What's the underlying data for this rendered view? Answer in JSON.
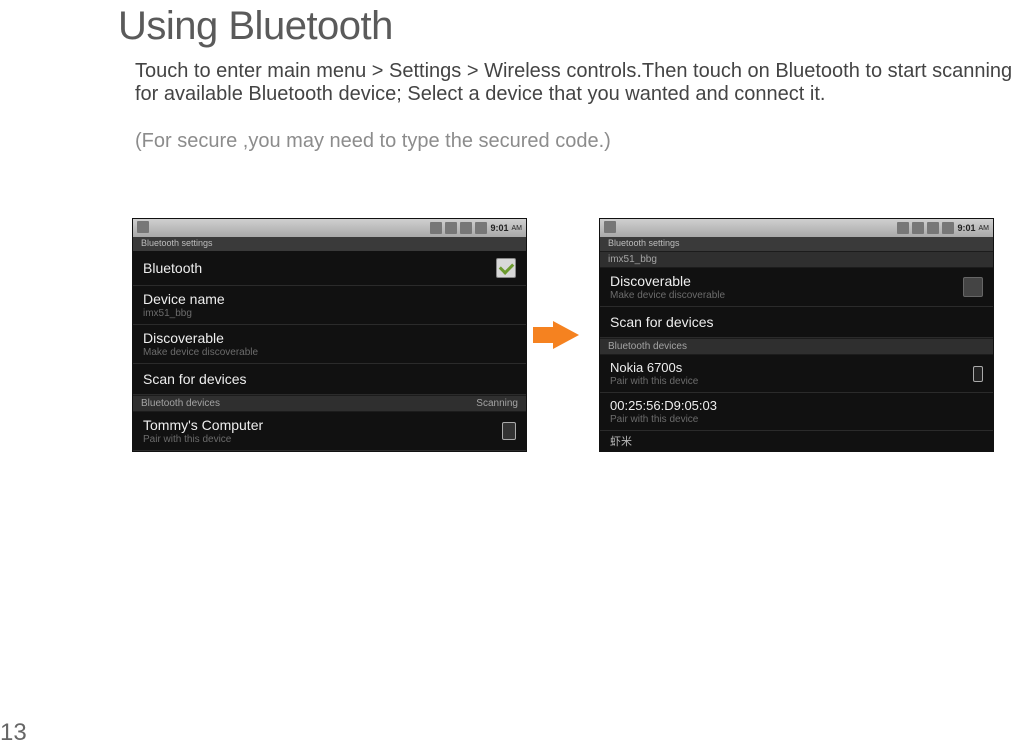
{
  "page": {
    "title": "Using Bluetooth",
    "para1": "Touch to enter main menu > Settings > Wireless controls.Then  touch on  Bluetooth to start scanning for available Bluetooth device; Select a device  that you wanted and connect it.",
    "para2": "(For secure ,you may need to type the secured code.)",
    "page_number": "13"
  },
  "status": {
    "time": "9:01",
    "ampm": "AM"
  },
  "screen1": {
    "header": "Bluetooth settings",
    "rows": {
      "bluetooth": "Bluetooth",
      "device_name": "Device name",
      "device_name_sub": "imx51_bbg",
      "discoverable": "Discoverable",
      "discoverable_sub": "Make device discoverable",
      "scan": "Scan for devices"
    },
    "section": {
      "label": "Bluetooth devices",
      "status": "Scanning"
    },
    "device": {
      "name": "Tommy's Computer",
      "sub": "Pair with this device"
    }
  },
  "screen2": {
    "header": "Bluetooth settings",
    "top_sub": "imx51_bbg",
    "rows": {
      "discoverable": "Discoverable",
      "discoverable_sub": "Make device discoverable",
      "scan": "Scan for devices"
    },
    "section": {
      "label": "Bluetooth devices"
    },
    "devices": [
      {
        "name": "Nokia 6700s",
        "sub": "Pair with this device"
      },
      {
        "name": "00:25:56:D9:05:03",
        "sub": "Pair with this device"
      }
    ],
    "tail": "虾米"
  }
}
